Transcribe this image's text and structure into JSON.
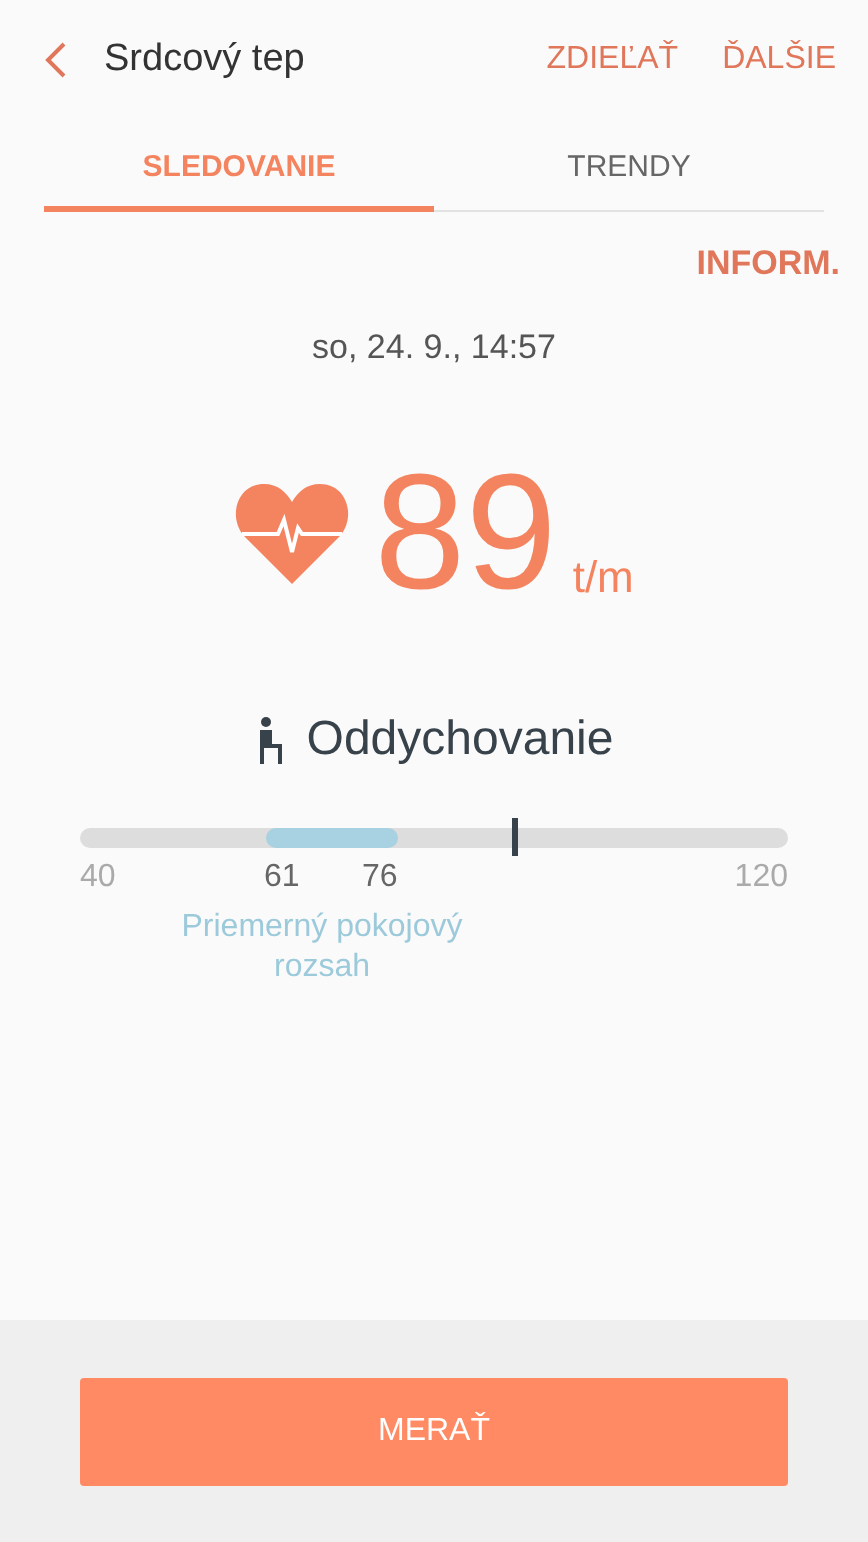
{
  "header": {
    "title": "Srdcový tep",
    "actions": [
      "ZDIEĽAŤ",
      "ĎALŠIE"
    ]
  },
  "tabs": [
    {
      "label": "SLEDOVANIE",
      "selected": true
    },
    {
      "label": "TRENDY",
      "selected": false
    }
  ],
  "info_link": "INFORM.",
  "timestamp": "so, 24. 9., 14:57",
  "reading": {
    "value": "89",
    "unit": "t/m"
  },
  "activity": "Oddychovanie",
  "range_bar": {
    "level": 0.613,
    "min_label": "40",
    "max_label": "120",
    "range_low": "61",
    "range_high": "76",
    "range_caption": "Priemerný pokojový rozsah"
  },
  "button": "MERAŤ"
}
